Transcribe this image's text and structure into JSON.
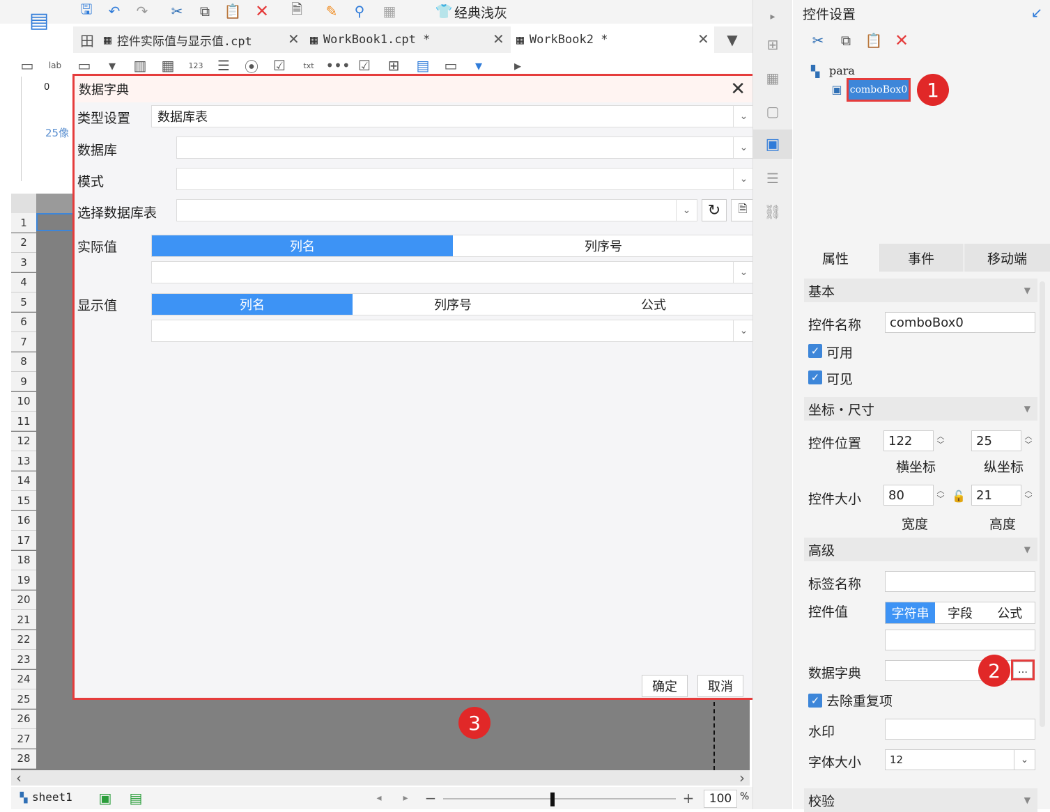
{
  "toolbar": {
    "theme_label": "经典浅灰"
  },
  "tabs": [
    {
      "label": "控件实际值与显示值.cpt"
    },
    {
      "label": "WorkBook1.cpt *"
    },
    {
      "label": "WorkBook2 *"
    }
  ],
  "ruler": {
    "zero": "0",
    "pixel_hint": "25像"
  },
  "rows": [
    "1",
    "2",
    "3",
    "4",
    "5",
    "6",
    "7",
    "8",
    "9",
    "10",
    "11",
    "12",
    "13",
    "14",
    "15",
    "16",
    "17",
    "18",
    "19",
    "20",
    "21",
    "22",
    "23",
    "24",
    "25",
    "26",
    "27",
    "28"
  ],
  "status": {
    "sheet": "sheet1",
    "zoom": "100",
    "percent": "%"
  },
  "right_panel": {
    "title": "控件设置",
    "tree": {
      "root": "para",
      "child": "comboBox0"
    },
    "tabs": [
      "属性",
      "事件",
      "移动端"
    ],
    "sections": {
      "basic": "基本",
      "coords": "坐标・尺寸",
      "advanced": "高级",
      "validate": "校验"
    },
    "fields": {
      "name_label": "控件名称",
      "name_value": "comboBox0",
      "enabled": "可用",
      "visible": "可见",
      "pos_label": "控件位置",
      "pos_x": "122",
      "pos_y": "25",
      "x_caption": "横坐标",
      "y_caption": "纵坐标",
      "size_label": "控件大小",
      "width": "80",
      "height": "21",
      "w_caption": "宽度",
      "h_caption": "高度",
      "tag_label": "标签名称",
      "value_label": "控件值",
      "value_modes": [
        "字符串",
        "字段",
        "公式"
      ],
      "dict_label": "数据字典",
      "dict_btn": "…",
      "dedupe": "去除重复项",
      "watermark": "水印",
      "fontsize_label": "字体大小",
      "fontsize_value": "12"
    }
  },
  "dialog": {
    "title": "数据字典",
    "type_label": "类型设置",
    "type_value": "数据库表",
    "db_label": "数据库",
    "schema_label": "模式",
    "table_label": "选择数据库表",
    "actual_label": "实际值",
    "actual_modes": [
      "列名",
      "列序号"
    ],
    "display_label": "显示值",
    "display_modes": [
      "列名",
      "列序号",
      "公式"
    ],
    "ok": "确定",
    "cancel": "取消"
  },
  "badges": [
    "1",
    "2",
    "3"
  ],
  "colors": {
    "accent": "#3d93f5",
    "highlight": "#e53c3c",
    "badge": "#e12828"
  }
}
